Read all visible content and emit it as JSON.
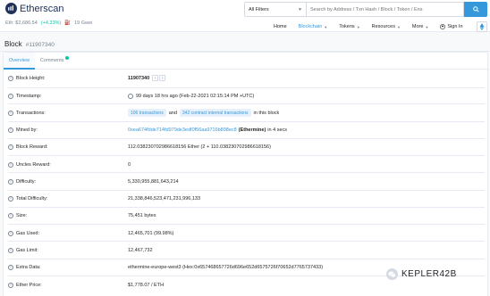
{
  "header": {
    "logo_text": "Etherscan",
    "eth_price_label": "Eth: $2,686.54",
    "eth_change": "(+4.33%)",
    "gas_label": "19 Gwei",
    "filter_label": "All Filters",
    "search_placeholder": "Search by Address / Txn Hash / Block / Token / Ens",
    "nav": [
      {
        "label": "Home"
      },
      {
        "label": "Blockchain"
      },
      {
        "label": "Tokens"
      },
      {
        "label": "Resources"
      },
      {
        "label": "More"
      },
      {
        "label": "Sign In"
      }
    ],
    "accent": "#3498db"
  },
  "page": {
    "title": "Block",
    "subtitle": "#11907340"
  },
  "tabs": [
    {
      "label": "Overview"
    },
    {
      "label": "Comments"
    }
  ],
  "rows": {
    "block_height": {
      "label": "Block Height:",
      "value": "11907340"
    },
    "timestamp": {
      "label": "Timestamp:",
      "value": "99 days 18 hrs ago (Feb-22-2021 02:15:14 PM +UTC)"
    },
    "transactions": {
      "label": "Transactions:",
      "badge1": "106 transactions",
      "and": "and",
      "badge2": "342 contract internal transactions",
      "suffix": "in this block"
    },
    "mined_by": {
      "label": "Mined by:",
      "address": "0xea674fdde714fd979de3edf0f56aa9716b898ec8",
      "name": "(Ethermine)",
      "suffix": "in 4 secs"
    },
    "block_reward": {
      "label": "Block Reward:",
      "value": "112.038230702986618156 Ether (2 + 110.038230702986618156)"
    },
    "uncles_reward": {
      "label": "Uncles Reward:",
      "value": "0"
    },
    "difficulty": {
      "label": "Difficulty:",
      "value": "5,330,955,881,643,214"
    },
    "total_difficulty": {
      "label": "Total Difficulty:",
      "value": "21,338,846,523,471,231,996,133"
    },
    "size": {
      "label": "Size:",
      "value": "75,451 bytes"
    },
    "gas_used": {
      "label": "Gas Used:",
      "value": "12,465,701 (99.98%)"
    },
    "gas_limit": {
      "label": "Gas Limit:",
      "value": "12,467,732"
    },
    "extra_data": {
      "label": "Extra Data:",
      "value": "ethermine-europe-west3 (Hex:0x657468657726d696e652d6575726f70652d7765737433)"
    },
    "ether_price": {
      "label": "Ether Price:",
      "value": "$1,778.07 / ETH"
    }
  },
  "watermark": {
    "text": "KEPLER42B"
  }
}
